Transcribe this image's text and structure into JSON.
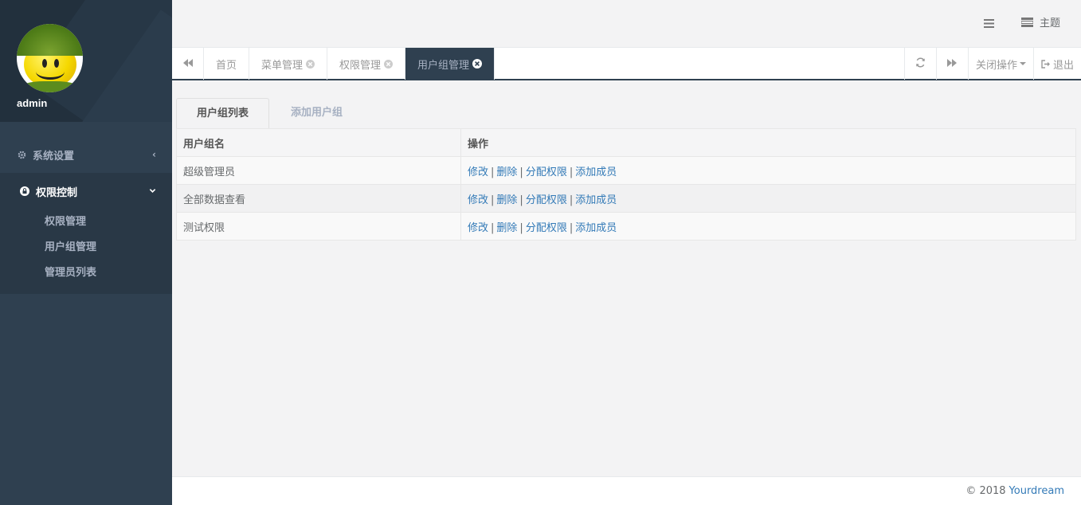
{
  "sidebar": {
    "username": "admin",
    "menu": [
      {
        "label": "系统设置",
        "icon": "gear-icon",
        "arrow": "‹"
      },
      {
        "label": "权限控制",
        "icon": "lock-icon",
        "arrow": "⌄",
        "children": [
          "权限管理",
          "用户组管理",
          "管理员列表"
        ]
      }
    ]
  },
  "topbar": {
    "menu_toggle_icon": "hamburger-icon",
    "theme_label": "主题"
  },
  "tabs": {
    "items": [
      {
        "label": "首页",
        "closable": false
      },
      {
        "label": "菜单管理",
        "closable": true
      },
      {
        "label": "权限管理",
        "closable": true
      },
      {
        "label": "用户组管理",
        "closable": true,
        "active": true
      }
    ],
    "close_ops_label": "关闭操作",
    "logout_label": "退出"
  },
  "content": {
    "tabs": [
      "用户组列表",
      "添加用户组"
    ],
    "table": {
      "headers": [
        "用户组名",
        "操作"
      ],
      "rows": [
        {
          "name": "超级管理员"
        },
        {
          "name": "全部数据查看"
        },
        {
          "name": "测试权限"
        }
      ],
      "actions": [
        "修改",
        "删除",
        "分配权限",
        "添加成员"
      ]
    }
  },
  "footer": {
    "copyright": "© 2018",
    "brand": "Yourdream"
  },
  "colors": {
    "sidebar_bg": "#2f4050",
    "link": "#337ab7",
    "active_tab": "#2f4050"
  }
}
